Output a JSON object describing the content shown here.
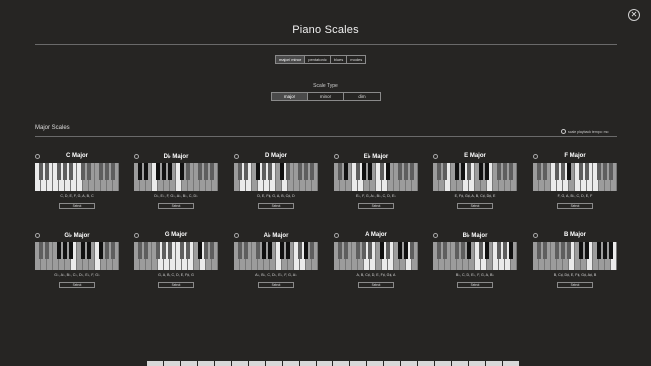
{
  "window": {
    "title": "Piano Scales",
    "close_glyph": "✕"
  },
  "modes": [
    {
      "label": "major/ minor",
      "active": true
    },
    {
      "label": "pentatonic",
      "active": false
    },
    {
      "label": "blues",
      "active": false
    },
    {
      "label": "modes",
      "active": false
    }
  ],
  "scale_type": {
    "label": "Scale Type",
    "options": [
      {
        "label": "major",
        "active": true
      },
      {
        "label": "minor",
        "active": false
      },
      {
        "label": "dim",
        "active": false
      }
    ]
  },
  "section": {
    "title": "Major Scales",
    "tempo_label": "scale playback tempo: mo"
  },
  "select_label": "Select",
  "scales": [
    {
      "name": "C Major",
      "notes": "C, D, E, F, G, A, B, C"
    },
    {
      "name": "D♭ Major",
      "notes": "D♭, E♭, F, G♭, A♭, B♭, C, D♭"
    },
    {
      "name": "D Major",
      "notes": "D, E, F♯, G, A, B, C♯, D"
    },
    {
      "name": "E♭ Major",
      "notes": "E♭, F, G, A♭, B♭, C, D, E♭"
    },
    {
      "name": "E Major",
      "notes": "E, F♯, G♯, A, B, C♯, D♯, E"
    },
    {
      "name": "F Major",
      "notes": "F, G, A, B♭, C, D, E, F"
    },
    {
      "name": "G♭ Major",
      "notes": "G♭, A♭, B♭, C♭, D♭, E♭, F, G♭"
    },
    {
      "name": "G Major",
      "notes": "G, A, B, C, D, E, F♯, G"
    },
    {
      "name": "A♭ Major",
      "notes": "A♭, B♭, C, D♭, E♭, F, G, A♭"
    },
    {
      "name": "A Major",
      "notes": "A, B, C♯, D, E, F♯, G♯, A"
    },
    {
      "name": "B♭ Major",
      "notes": "B♭, C, D, E♭, F, G, A, B♭"
    },
    {
      "name": "B Major",
      "notes": "B, C♯, D♯, E, F♯, G♯, A♯, B"
    }
  ]
}
